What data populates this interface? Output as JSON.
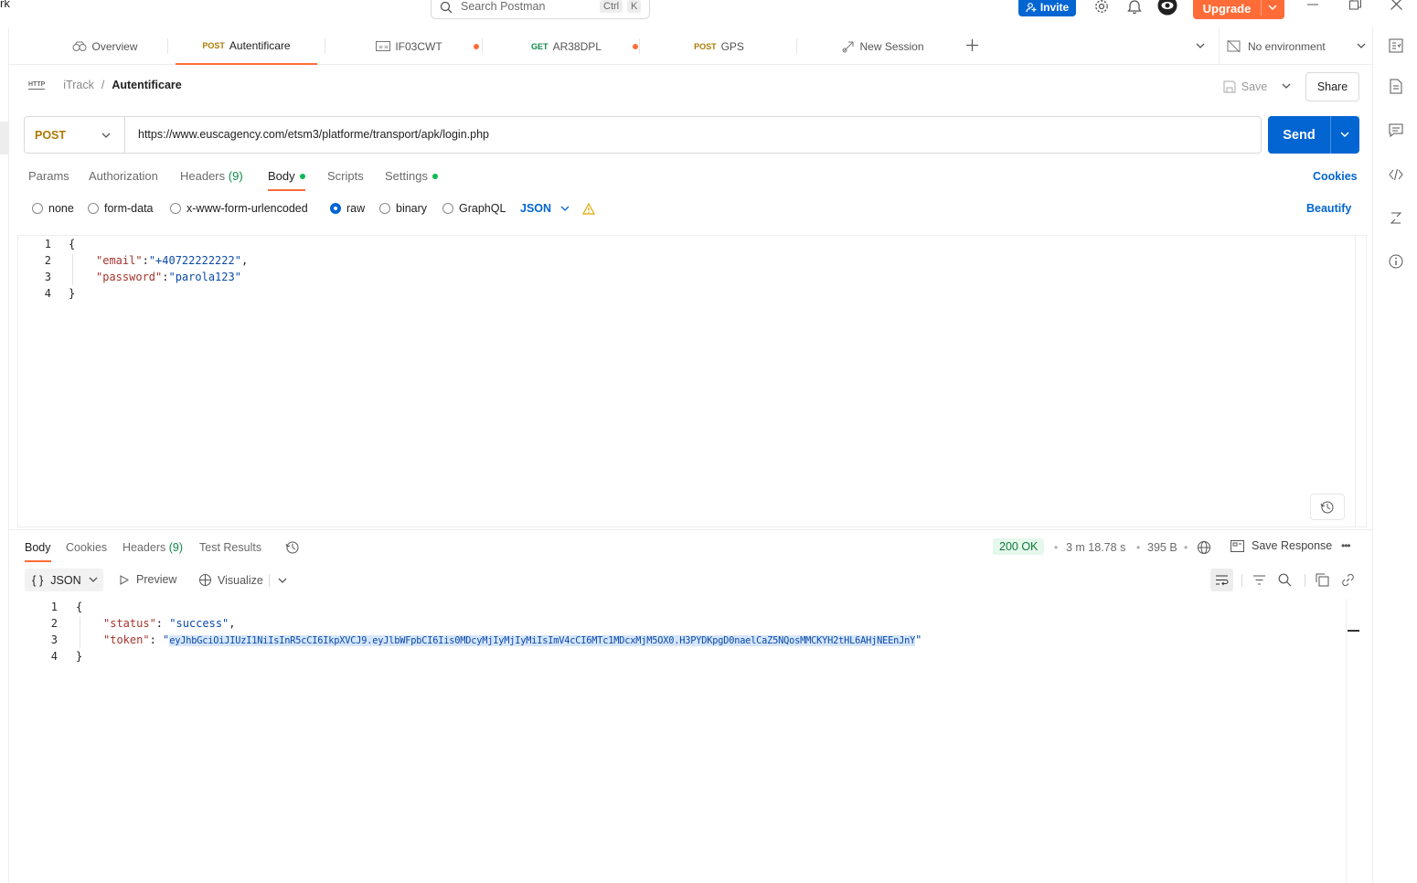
{
  "topbar": {
    "workspace_fragment": "rk",
    "search_placeholder": "Search Postman",
    "search_kbd1": "Ctrl",
    "search_kbd2": "K",
    "invite_label": "Invite",
    "upgrade_label": "Upgrade"
  },
  "tabs": [
    {
      "method": "",
      "label": "Overview"
    },
    {
      "method": "POST",
      "label": "Autentificare"
    },
    {
      "method": "",
      "label": "IF03CWT"
    },
    {
      "method": "GET",
      "label": "AR38DPL"
    },
    {
      "method": "POST",
      "label": "GPS"
    },
    {
      "method": "",
      "label": "New Session"
    }
  ],
  "environment": "No environment",
  "breadcrumb": {
    "badge": "HTTP",
    "collection": "iTrack",
    "separator": "/",
    "request": "Autentificare"
  },
  "actions": {
    "save": "Save",
    "share": "Share"
  },
  "request": {
    "method": "POST",
    "url": "https://www.euscagency.com/etsm3/platforme/transport/apk/login.php",
    "send": "Send"
  },
  "request_tabs": {
    "params": "Params",
    "authorization": "Authorization",
    "headers": "Headers",
    "headers_count": "(9)",
    "body": "Body",
    "scripts": "Scripts",
    "settings": "Settings",
    "cookies": "Cookies"
  },
  "body_types": {
    "none": "none",
    "form_data": "form-data",
    "urlencoded": "x-www-form-urlencoded",
    "raw": "raw",
    "binary": "binary",
    "graphql": "GraphQL",
    "format": "JSON",
    "beautify": "Beautify"
  },
  "request_body": {
    "line_numbers": [
      "1",
      "2",
      "3",
      "4"
    ],
    "open": "{",
    "email_key": "\"email\"",
    "email_value": "\"+40722222222\"",
    "password_key": "\"password\"",
    "password_value": "\"parola123\"",
    "close": "}"
  },
  "response_tabs": {
    "body": "Body",
    "cookies": "Cookies",
    "headers": "Headers",
    "headers_count": "(9)",
    "test_results": "Test Results"
  },
  "response_meta": {
    "status": "200 OK",
    "time": "3 m 18.78 s",
    "size": "395 B",
    "save_response": "Save Response"
  },
  "response_toolbar": {
    "format": "JSON",
    "preview": "Preview",
    "visualize": "Visualize"
  },
  "response_body": {
    "line_numbers": [
      "1",
      "2",
      "3",
      "4"
    ],
    "open": "{",
    "status_key": "\"status\"",
    "status_value": "\"success\"",
    "token_key": "\"token\"",
    "token_value": "eyJhbGciOiJIUzI1NiIsInR5cCI6IkpXVCJ9.eyJlbWFpbCI6Iis0MDcyMjIyMjIyMiIsImV4cCI6MTc1MDcxMjM5OX0.H3PYDKpgD0naelCaZ5NQosMMCKYH2tHL6AHjNEEnJnY",
    "close": "}"
  },
  "colors": {
    "accent": "#ff6c37",
    "primary": "#0265d2",
    "success": "#0cbb52"
  }
}
